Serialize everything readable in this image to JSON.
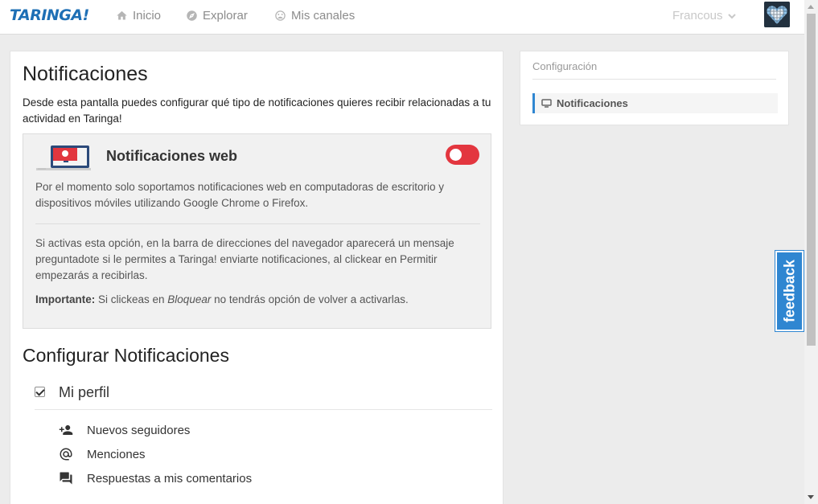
{
  "header": {
    "logo": "TARINGA!",
    "nav": [
      {
        "label": "Inicio",
        "icon": "home-icon"
      },
      {
        "label": "Explorar",
        "icon": "compass-icon"
      },
      {
        "label": "Mis canales",
        "icon": "smiley-icon"
      }
    ],
    "user": "Francous"
  },
  "main": {
    "title": "Notificaciones",
    "description": "Desde esta pantalla puedes configurar qué tipo de notificaciones quieres recibir relacionadas a tu actividad en Taringa!",
    "web_box": {
      "title": "Notificaciones web",
      "toggle_state": "off",
      "p1": "Por el momento solo soportamos notificaciones web en computadoras de escritorio y dispositivos móviles utilizando Google Chrome o Firefox.",
      "p2": "Si activas esta opción, en la barra de direcciones del navegador aparecerá un mensaje preguntadote si le permites a Taringa! enviarte notificaciones, al clickear en Permitir empezarás a recibirlas.",
      "p3_bold": "Importante:",
      "p3_a": " Si clickeas en ",
      "p3_italic": "Bloquear",
      "p3_b": " no tendrás opción de volver a activarlas."
    },
    "configure_title": "Configurar Notificaciones",
    "profile_label": "Mi perfil",
    "profile_checked": true,
    "items": [
      {
        "label": "Nuevos seguidores",
        "icon": "add-person-icon"
      },
      {
        "label": "Menciones",
        "icon": "at-icon"
      },
      {
        "label": "Respuestas a mis comentarios",
        "icon": "chat-icon"
      }
    ]
  },
  "sidebar": {
    "title": "Configuración",
    "item": "Notificaciones"
  },
  "feedback": {
    "label": "feedback"
  },
  "colors": {
    "brand": "#1e6fb5",
    "toggle": "#e3363f",
    "accent": "#2f86d1"
  }
}
